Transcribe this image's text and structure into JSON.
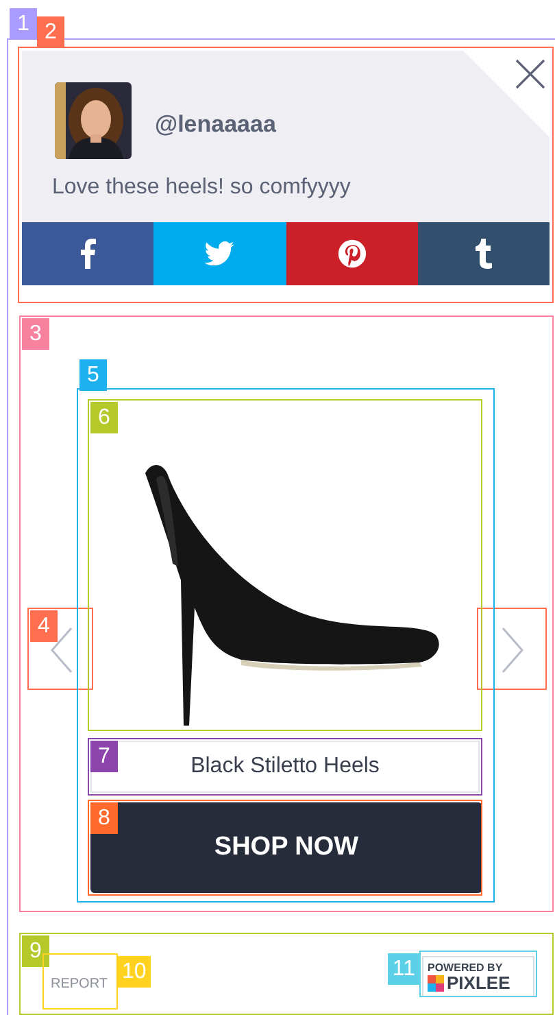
{
  "post": {
    "username": "@lenaaaaa",
    "caption": "Love these heels! so comfyyyy"
  },
  "share_buttons": [
    {
      "kind": "facebook",
      "color": "#3b5998"
    },
    {
      "kind": "twitter",
      "color": "#00aced"
    },
    {
      "kind": "pinterest",
      "color": "#cb2027"
    },
    {
      "kind": "tumblr",
      "color": "#32506d"
    }
  ],
  "product": {
    "title": "Black Stiletto Heels",
    "button": "SHOP NOW"
  },
  "footer": {
    "report": "REPORT",
    "badge_top": "POWERED BY",
    "badge_bottom": "PIXLEE"
  },
  "annotations": [
    {
      "label": "1",
      "color": "#a99bff"
    },
    {
      "label": "2",
      "color": "#ff6f4f"
    },
    {
      "label": "3",
      "color": "#f7819f"
    },
    {
      "label": "4",
      "color": "#ff6f4f"
    },
    {
      "label": "5",
      "color": "#1fb0f0"
    },
    {
      "label": "6",
      "color": "#b5c92a"
    },
    {
      "label": "7",
      "color": "#8e44ad"
    },
    {
      "label": "8",
      "color": "#ff6a2a"
    },
    {
      "label": "9",
      "color": "#b5c92a"
    },
    {
      "label": "10",
      "color": "#ffd21f"
    },
    {
      "label": "11",
      "color": "#5bd0e6"
    }
  ]
}
